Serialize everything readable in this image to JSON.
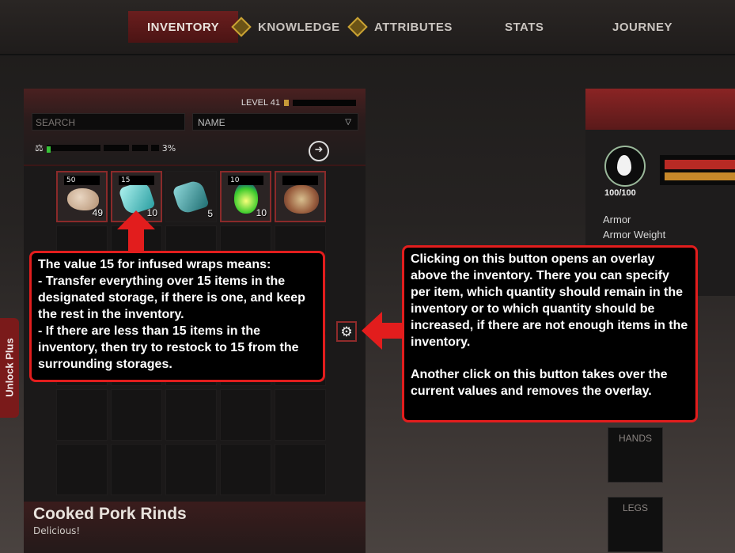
{
  "tabs": [
    {
      "label": "INVENTORY",
      "active": true,
      "icon": ""
    },
    {
      "label": "KNOWLEDGE",
      "active": false,
      "icon": "diamond-icon"
    },
    {
      "label": "ATTRIBUTES",
      "active": false,
      "icon": "diamond-icon"
    },
    {
      "label": "STATS",
      "active": false,
      "icon": ""
    },
    {
      "label": "JOURNEY",
      "active": false,
      "icon": ""
    }
  ],
  "inventory": {
    "level_label": "LEVEL 41",
    "search_placeholder": "SEARCH",
    "sort_value": "NAME",
    "weight_percent": "3%",
    "items": [
      {
        "icon": "pork-rind-icon",
        "limit": "50",
        "quantity": "49"
      },
      {
        "icon": "infused-wraps-icon",
        "limit": "15",
        "quantity": "10"
      },
      {
        "icon": "wraps-icon",
        "limit": "",
        "quantity": "5"
      },
      {
        "icon": "potion-icon",
        "limit": "10",
        "quantity": "10"
      },
      {
        "icon": "meat-icon",
        "limit": "",
        "quantity": ""
      }
    ]
  },
  "selected_item": {
    "name": "Cooked Pork Rinds",
    "description": "Delicious!"
  },
  "sidebar": {
    "unlock_label": "Unlock Plus"
  },
  "character": {
    "health_label": "100/100",
    "armor_label": "Armor",
    "armor_weight_label": "Armor Weight",
    "slots": [
      "HANDS",
      "LEGS"
    ]
  },
  "callouts": {
    "left_title": "The value 15 for infused wraps means:",
    "left_line1": "- Transfer everything over 15 items in the designated storage, if there is one, and keep the rest in the inventory.",
    "left_line2": "- If there are less than 15 items in the inventory, then try to restock to 15 from the surrounding storages.",
    "right_para1": "Clicking on this button opens an overlay above the inventory. There you can specify per item, which quantity should remain in the inventory or to which quantity should be increased, if there are not enough items in the inventory.",
    "right_para2": "Another click on this button takes over the current values and removes the overlay."
  },
  "colors": {
    "accent_red": "#e21d1d",
    "tab_active": "#6a1e1e",
    "gold": "#c9a233"
  }
}
